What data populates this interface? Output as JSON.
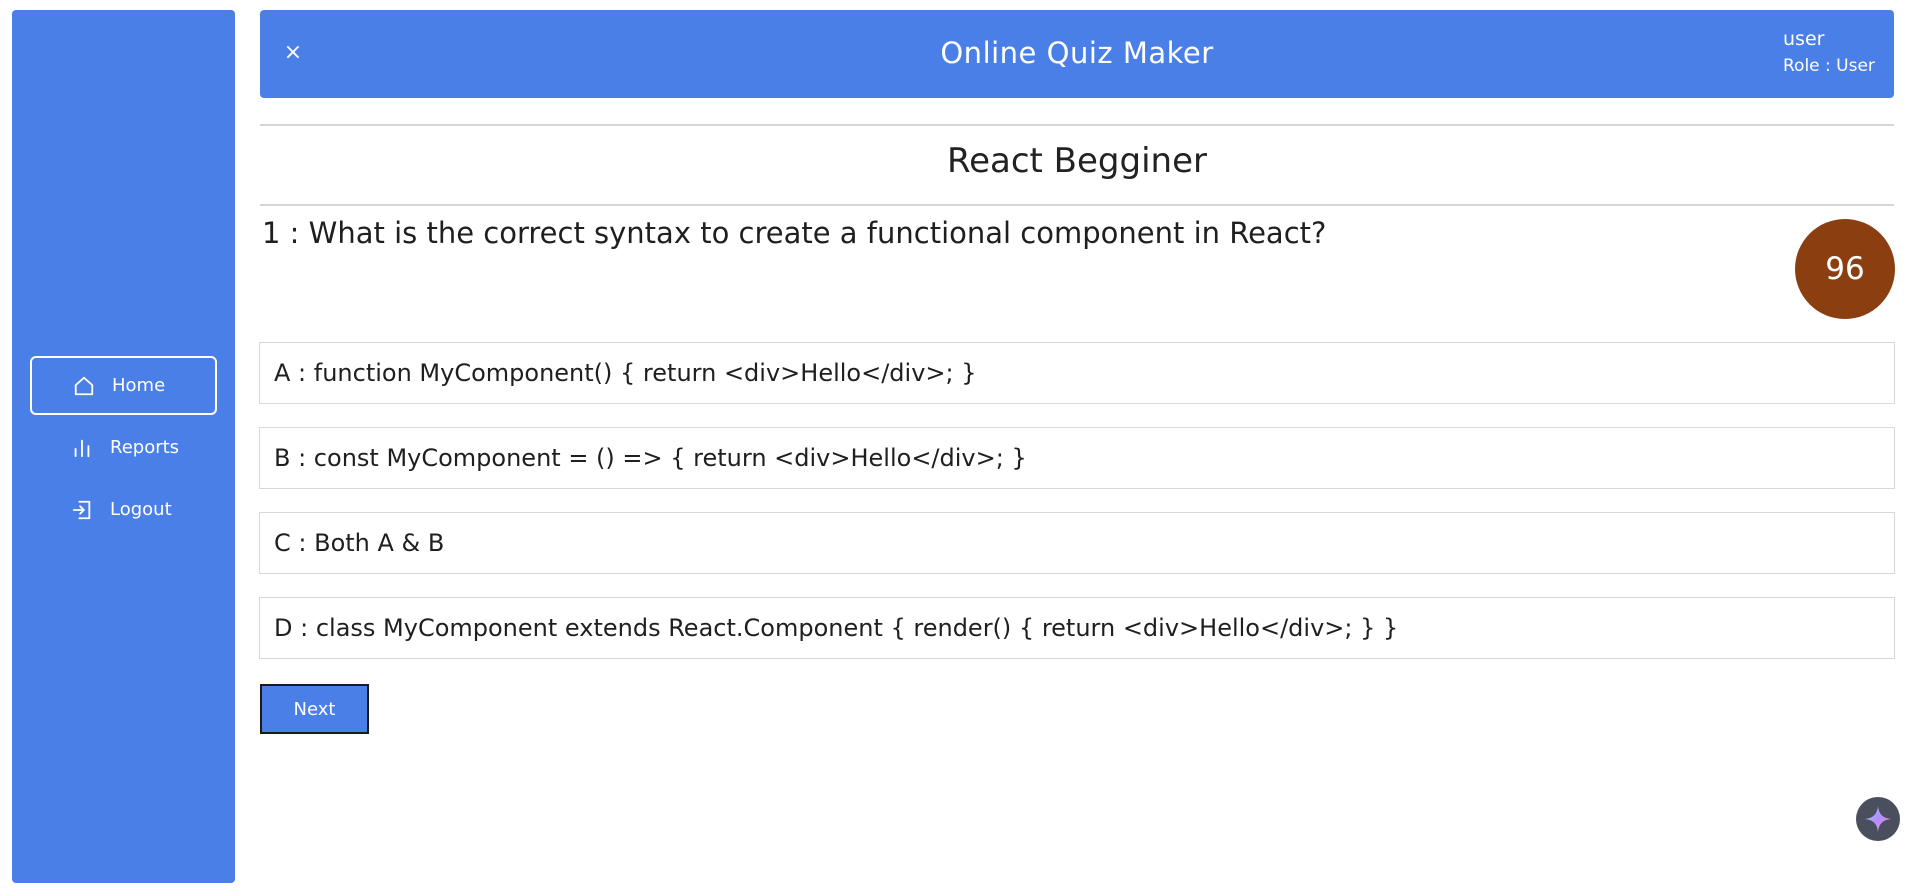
{
  "header": {
    "close_label": "×",
    "title": "Online Quiz Maker",
    "user_name": "user",
    "user_role": "Role : User"
  },
  "sidebar": {
    "items": [
      {
        "label": "Home",
        "icon": "home-icon",
        "active": true
      },
      {
        "label": "Reports",
        "icon": "bar-chart-icon",
        "active": false
      },
      {
        "label": "Logout",
        "icon": "logout-icon",
        "active": false
      }
    ]
  },
  "quiz": {
    "title": "React Begginer",
    "question": "1 : What is the correct syntax to create a functional component in React?",
    "timer": "96",
    "options": [
      "A : function MyComponent() { return <div>Hello</div>; }",
      "B : const MyComponent = () => { return <div>Hello</div>; }",
      "C : Both A & B",
      "D : class MyComponent extends React.Component { render() { return <div>Hello</div>; } }"
    ],
    "next_label": "Next"
  },
  "colors": {
    "primary": "#4b7fe8",
    "timer_bg": "#8b3e10",
    "border": "#d8d8d8"
  },
  "fab": {
    "icon": "sparkle-icon"
  }
}
